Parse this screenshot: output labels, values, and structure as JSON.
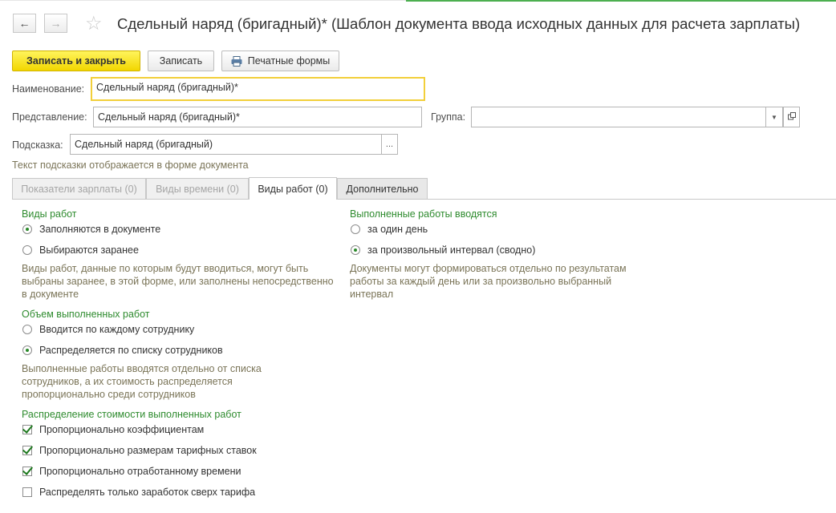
{
  "window": {
    "title": "Сдельный наряд (бригадный)* (Шаблон документа ввода исходных данных для расчета зарплаты)",
    "accent": "#4caf50"
  },
  "nav": {
    "back_icon": "arrow-left-icon",
    "forward_icon": "arrow-right-icon",
    "favorite_icon": "star-icon"
  },
  "toolbar": {
    "save_close_label": "Записать и закрыть",
    "save_label": "Записать",
    "print_label": "Печатные формы",
    "primary_color": "#f2d600"
  },
  "form": {
    "name_label": "Наименование:",
    "name_value": "Сдельный наряд (бригадный)*",
    "presentation_label": "Представление:",
    "presentation_value": "Сдельный наряд (бригадный)*",
    "group_label": "Группа:",
    "group_value": "",
    "tooltip_label": "Подсказка:",
    "tooltip_value": "Сдельный наряд (бригадный)",
    "tooltip_hint": "Текст подсказки отображается в форме документа"
  },
  "tabs": [
    {
      "label": "Показатели зарплаты (0)",
      "active": false
    },
    {
      "label": "Виды времени (0)",
      "active": false
    },
    {
      "label": "Виды работ (0)",
      "active": true
    },
    {
      "label": "Дополнительно",
      "active": false
    }
  ],
  "work_types": {
    "title": "Виды работ",
    "option1": "Заполняются в документе",
    "option2": "Выбираются заранее",
    "selected": 1,
    "desc_lines": [
      "Виды работ, данные по которым будут вводиться, могут быть",
      "выбраны заранее, в этой форме, или заполнены непосредственно",
      "в документе"
    ]
  },
  "entered_works": {
    "title": "Выполненные работы вводятся",
    "option1": "за один день",
    "option2": "за произвольный интервал (сводно)",
    "selected": 2,
    "desc_lines": [
      "Документы могут формироваться отдельно по результатам",
      "работы за каждый день или за произвольно выбранный",
      "интервал"
    ]
  },
  "volume": {
    "title": "Объем выполненных работ",
    "option1": "Вводится по каждому сотруднику",
    "option2": "Распределяется по списку сотрудников",
    "selected": 2,
    "desc_lines": [
      "Выполненные работы вводятся отдельно от списка",
      "сотрудников, а их стоимость распределяется",
      "пропорционально среди сотрудников"
    ]
  },
  "distribution": {
    "title": "Распределение стоимости выполненных работ",
    "items": [
      {
        "label": "Пропорционально коэффициентам",
        "checked": true
      },
      {
        "label": "Пропорционально размерам тарифных ставок",
        "checked": true
      },
      {
        "label": "Пропорционально отработанному времени",
        "checked": true
      },
      {
        "label": "Распределять только заработок сверх тарифа",
        "checked": false
      }
    ]
  }
}
